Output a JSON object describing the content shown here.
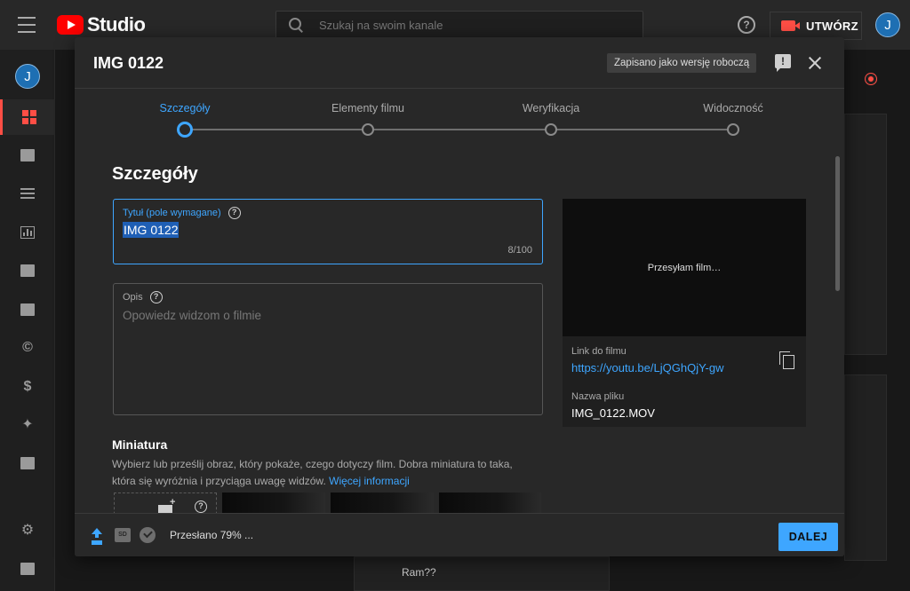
{
  "header": {
    "logo_text": "Studio",
    "search_placeholder": "Szukaj na swoim kanale",
    "help_glyph": "?",
    "create_label": "UTWÓRZ",
    "avatar_initial": "J"
  },
  "sidebar": {
    "avatar_initial": "J",
    "items": [
      {
        "name": "dashboard",
        "active": true
      },
      {
        "name": "content"
      },
      {
        "name": "playlists"
      },
      {
        "name": "analytics"
      },
      {
        "name": "comments"
      },
      {
        "name": "subtitles"
      },
      {
        "name": "copyright",
        "glyph": "©"
      },
      {
        "name": "monetization",
        "glyph": "$"
      },
      {
        "name": "customization"
      },
      {
        "name": "audio-library"
      },
      {
        "name": "settings"
      },
      {
        "name": "feedback"
      }
    ]
  },
  "background": {
    "comment_text": "Ram??"
  },
  "modal": {
    "title": "IMG 0122",
    "draft_badge": "Zapisano jako wersję roboczą",
    "steps": [
      {
        "label": "Szczegóły",
        "active": true
      },
      {
        "label": "Elementy filmu"
      },
      {
        "label": "Weryfikacja"
      },
      {
        "label": "Widoczność"
      }
    ],
    "section_title": "Szczegóły",
    "title_field": {
      "label": "Tytuł (pole wymagane)",
      "value": "IMG 0122",
      "counter": "8/100"
    },
    "description_field": {
      "label": "Opis",
      "placeholder": "Opowiedz widzom o filmie"
    },
    "thumbnail": {
      "title": "Miniatura",
      "description": "Wybierz lub prześlij obraz, który pokaże, czego dotyczy film. Dobra miniatura to taka, która się wyróżnia i przyciąga uwagę widzów.",
      "more_link": "Więcej informacji"
    },
    "preview": {
      "status": "Przesyłam film…",
      "link_label": "Link do filmu",
      "link": "https://youtu.be/LjQGhQjY-gw",
      "filename_label": "Nazwa pliku",
      "filename": "IMG_0122.MOV"
    },
    "footer": {
      "sd_badge": "SD",
      "status": "Przesłano 79% ...",
      "next_label": "DALEJ"
    }
  },
  "colors": {
    "accent": "#3ea6ff",
    "brand_red": "#ff0000",
    "modal_bg": "#282828",
    "page_bg": "#181818"
  }
}
